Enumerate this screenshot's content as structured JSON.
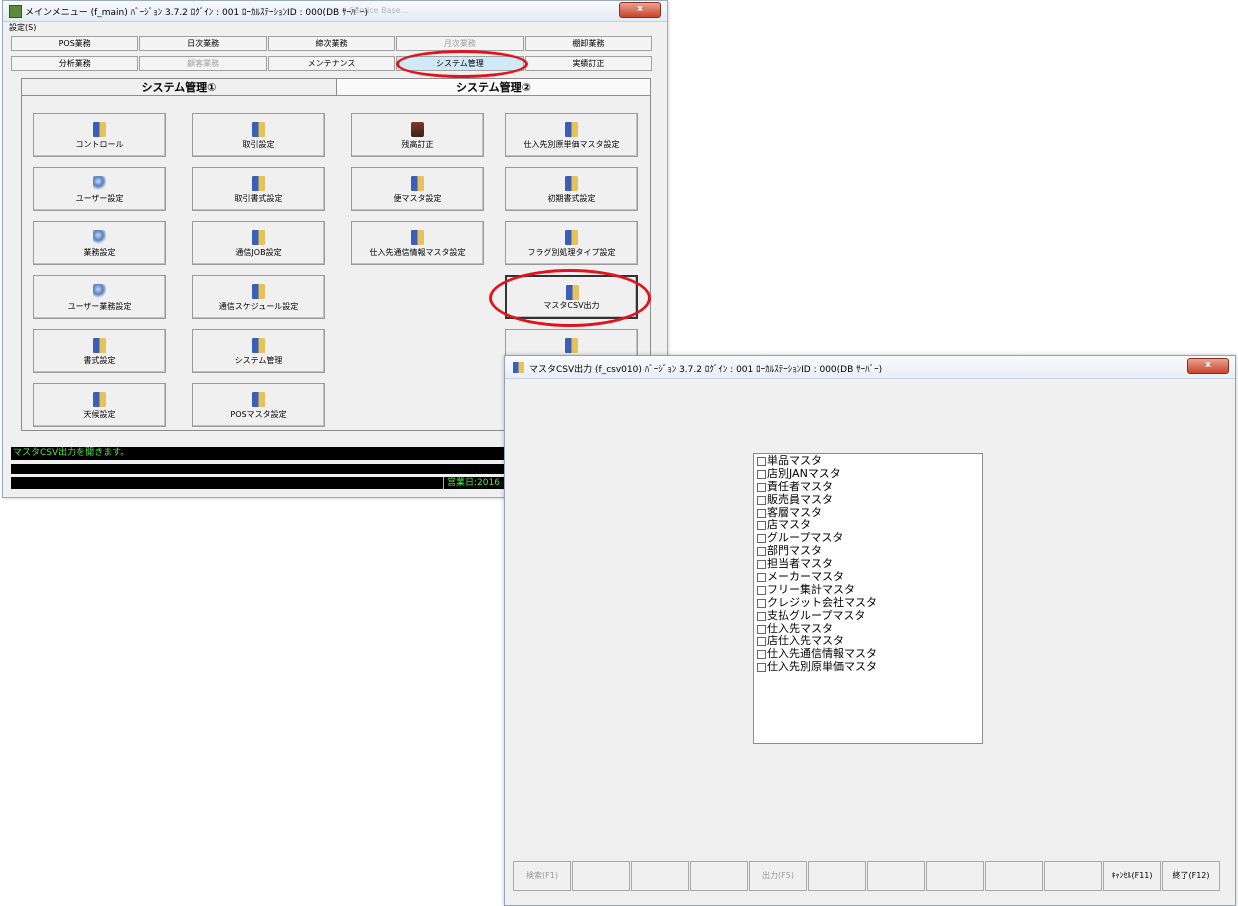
{
  "main_window": {
    "title": "メインメニュー (f_main) ﾊﾞｰｼﾞｮﾝ 3.7.2 ﾛｸﾞｲﾝ : 001 ﾛｰｶﾙｽﾃｰｼｮﾝID : 000(DB ｻｰﾊﾞｰ)",
    "title_ghost": "Service Base...",
    "close_label": "x",
    "menu": "設定(S)",
    "nav_row1": [
      "POS業務",
      "日次業務",
      "締次業務",
      "月次業務",
      "棚卸業務"
    ],
    "nav_row2": [
      "分析業務",
      "顧客業務",
      "メンテナンス",
      "システム管理",
      "実績訂正"
    ],
    "tab1": "システム管理①",
    "tab2": "システム管理②",
    "functions": {
      "col1": [
        "コントロール",
        "ユーザー設定",
        "業務設定",
        "ユーザー業務設定",
        "書式設定",
        "天候設定"
      ],
      "col2": [
        "取引設定",
        "取引書式設定",
        "通信JOB設定",
        "通信スケジュール設定",
        "システム管理",
        "POSマスタ設定"
      ],
      "col3": [
        "残高訂正",
        "便マスタ設定",
        "仕入先通信情報マスタ設定"
      ],
      "col4": [
        "仕入先別原単価マスタ設定",
        "初期書式設定",
        "フラグ別処理タイプ設定",
        "マスタCSV出力"
      ]
    },
    "status_message": "マスタCSV出力を開きます。",
    "business_date": "営業日:2016"
  },
  "dialog": {
    "title": "マスタCSV出力 (f_csv010) ﾊﾞｰｼﾞｮﾝ 3.7.2 ﾛｸﾞｲﾝ : 001 ﾛｰｶﾙｽﾃｰｼｮﾝID : 000(DB ｻｰﾊﾞｰ)",
    "close_label": "x",
    "list_items": [
      "単品マスタ",
      "店別JANマスタ",
      "責任者マスタ",
      "販売員マスタ",
      "客層マスタ",
      "店マスタ",
      "グループマスタ",
      "部門マスタ",
      "担当者マスタ",
      "メーカーマスタ",
      "フリー集計マスタ",
      "クレジット会社マスタ",
      "支払グループマスタ",
      "仕入先マスタ",
      "店仕入先マスタ",
      "仕入先通信情報マスタ",
      "仕入先別原単価マスタ"
    ],
    "fkeys": [
      "検索(F1)",
      "",
      "",
      "",
      "出力(F5)",
      "",
      "",
      "",
      "",
      "",
      "ｷｬﾝｾﾙ(F11)",
      "終了(F12)"
    ]
  }
}
